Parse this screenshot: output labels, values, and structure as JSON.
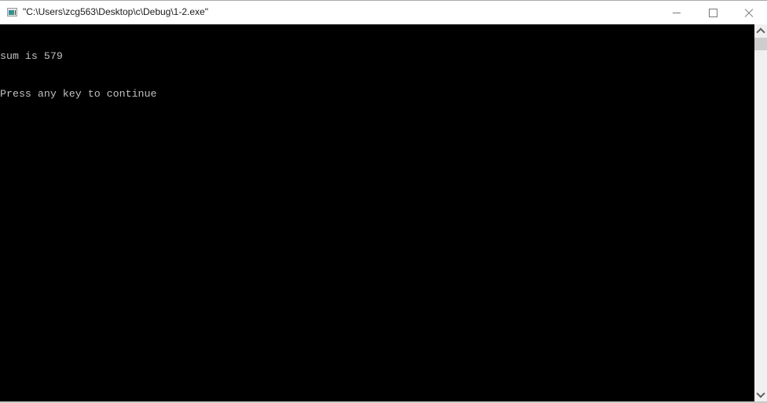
{
  "window": {
    "title": "\"C:\\Users\\zcg563\\Desktop\\c\\Debug\\1-2.exe\"",
    "icon": "console-app-icon",
    "controls": {
      "minimize": "minimize-icon",
      "maximize": "maximize-icon",
      "close": "close-icon"
    }
  },
  "console": {
    "lines": [
      "sum is 579",
      "Press any key to continue"
    ],
    "background": "#000000",
    "foreground": "#c0c0c0"
  },
  "scrollbar": {
    "up": "chevron-up-icon",
    "down": "chevron-down-icon"
  }
}
